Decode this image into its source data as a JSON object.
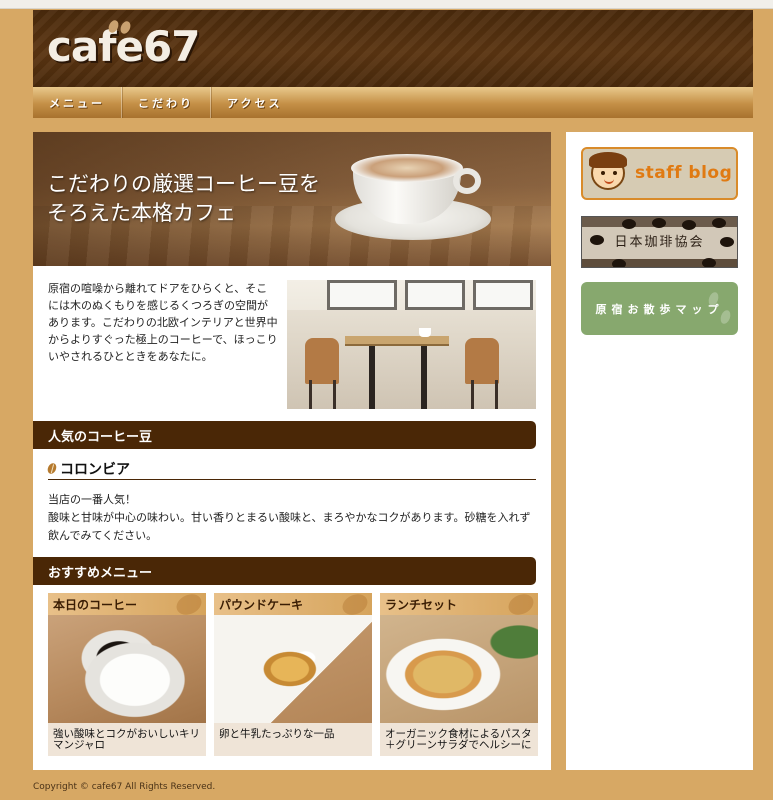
{
  "site": {
    "logo": "cafe67"
  },
  "nav": {
    "items": [
      "メニュー",
      "こだわり",
      "アクセス"
    ]
  },
  "hero": {
    "line1": "こだわりの厳選コーヒー豆を",
    "line2": "そろえた本格カフェ"
  },
  "intro": {
    "text": "原宿の喧噪から離れてドアをひらくと、そこには木のぬくもりを感じるくつろぎの空間があります。こだわりの北欧インテリアと世界中からよりすぐった極上のコーヒーで、ほっこりいやされるひとときをあなたに。"
  },
  "popular": {
    "title": "人気のコーヒー豆",
    "item_name": "コロンビア",
    "line1": "当店の一番人気！",
    "line2": "酸味と甘味が中心の味わい。甘い香りとまるい酸味と、まろやかなコクがあります。砂糖を入れず飲んでみてください。"
  },
  "recommend": {
    "title": "おすすめメニュー",
    "items": [
      {
        "name": "本日のコーヒー",
        "caption": "強い酸味とコクがおいしいキリマンジャロ"
      },
      {
        "name": "パウンドケーキ",
        "caption": "卵と牛乳たっぷりな一品"
      },
      {
        "name": "ランチセット",
        "caption": "オーガニック食材によるパスタ＋グリーンサラダでヘルシーに"
      }
    ]
  },
  "sidebar": {
    "staff_blog": "staff blog",
    "coffee_assoc": "日本珈琲協会",
    "walk_map": "原宿お散歩マップ"
  },
  "footer": {
    "copyright": "Copyright © cafe67 All Rights Reserved."
  },
  "colors": {
    "background": "#d7a864",
    "header": "#4a2a0c",
    "accent_bar": "#4a2706",
    "nav": "#c48f46",
    "map_banner": "#87a86e",
    "staff_border": "#d98b2a"
  }
}
